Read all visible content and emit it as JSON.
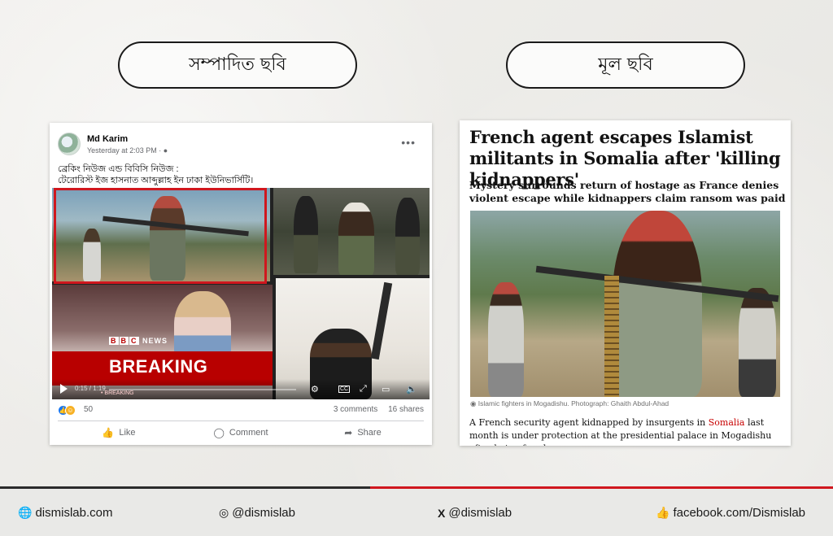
{
  "labels": {
    "edited": "সম্পাদিত ছবি",
    "original": "মূল ছবি"
  },
  "facebook_post": {
    "author": "Md Karim",
    "timestamp": "Yesterday at 2:03 PM ·",
    "text_line1": "ব্রেকিং নিউজ এন্ড বিবিসি নিউজ :",
    "text_line2": "টেরোরিস্ট ইজ হাসনাত আব্দুল্লাহ ইন ঢাকা ইউনিভার্সিটি।",
    "video": {
      "bbc_news": "NEWS",
      "breaking": "BREAKING",
      "time": "0:15 / 1:19",
      "ticker": "• BREAKING",
      "cc": "CC"
    },
    "reaction_count": "50",
    "comments": "3 comments",
    "shares": "16 shares",
    "actions": {
      "like": "Like",
      "comment": "Comment",
      "share": "Share"
    }
  },
  "article": {
    "headline": "French agent escapes Islamist militants in Somalia after 'killing kidnappers'",
    "standfirst": "Mystery surrounds return of hostage as France denies violent escape while kidnappers claim ransom was paid",
    "caption": "Islamic fighters in Mogadishu. Photograph: Ghaith Abdul-Ahad",
    "body_before": "A French security agent kidnapped by insurgents in ",
    "body_link": "Somalia",
    "body_after": " last month is under protection at the presidential palace in Mogadishu after being freed."
  },
  "footer": {
    "website": "dismislab.com",
    "instagram": "@dismislab",
    "x": "@dismislab",
    "facebook": "facebook.com/Dismislab"
  },
  "colors": {
    "accent_red": "#d0171e",
    "bbc_red": "#b80000",
    "facebook_blue": "#1877f2",
    "guardian_link": "#c70000"
  }
}
